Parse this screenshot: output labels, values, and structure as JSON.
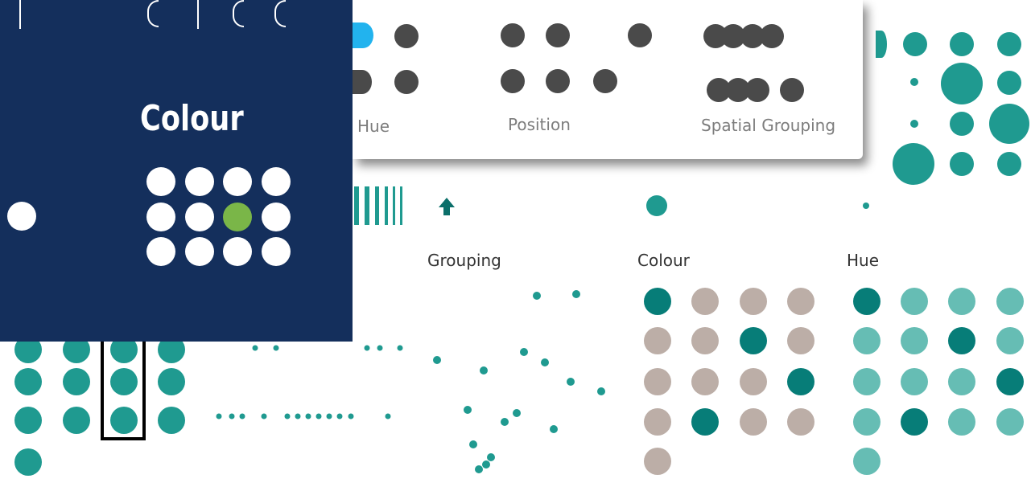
{
  "navy_panel": {
    "heading": "Colour",
    "background": "#142f5c",
    "dot_color": "#ffffff",
    "highlight_color": "#7ab648",
    "grid": {
      "rows": 3,
      "cols": 4,
      "highlighted": [
        1,
        2
      ]
    }
  },
  "white_card": {
    "labels": {
      "hue": "Hue",
      "position": "Position",
      "spatial_grouping": "Spatial Grouping"
    },
    "dot_color": "#4a4a4a",
    "hue_accent": "#22b3ee"
  },
  "teal_sections": {
    "grouping_label": "Grouping",
    "colour_label": "Colour",
    "hue_label": "Hue",
    "teal": "#1f9a90",
    "dark_teal": "#077d78",
    "light_teal": "#66bdb4",
    "grey": "#bcaea7",
    "colour_grid": [
      [
        "dark",
        "grey",
        "grey",
        "grey"
      ],
      [
        "grey",
        "grey",
        "dark",
        "grey"
      ],
      [
        "grey",
        "grey",
        "grey",
        "dark"
      ],
      [
        "grey",
        "dark",
        "grey",
        "grey"
      ],
      [
        "grey"
      ]
    ],
    "hue_grid": [
      [
        "dark",
        "light",
        "light",
        "light"
      ],
      [
        "light",
        "light",
        "dark",
        "light"
      ],
      [
        "light",
        "light",
        "light",
        "dark"
      ],
      [
        "light",
        "dark",
        "light",
        "light"
      ],
      [
        "light"
      ]
    ]
  },
  "icons": {
    "up_arrow": "arrow-up-icon",
    "barcode": "vertical-bars-icon",
    "selection_box": "selection-rectangle-icon"
  }
}
